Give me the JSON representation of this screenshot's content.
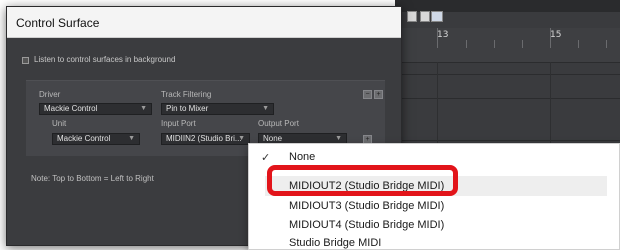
{
  "timeline": {
    "markers": [
      "13",
      "15"
    ]
  },
  "dialog": {
    "title": "Control Surface",
    "background_listen_label": "Listen to control surfaces in background",
    "headers": {
      "driver": "Driver",
      "track_filtering": "Track Filtering",
      "unit": "Unit",
      "input_port": "Input Port",
      "output_port": "Output Port"
    },
    "driver_value": "Mackie Control",
    "track_filtering_value": "Pin to Mixer",
    "unit_value": "Mackie Control",
    "input_port_value": "MIDIIN2 (Studio Bri...",
    "output_port_value": "None",
    "note": "Note: Top to Bottom = Left to Right"
  },
  "menu": {
    "items": [
      {
        "label": "None",
        "checked": true
      },
      {
        "label": "MIDIOUT2 (Studio Bridge MIDI)",
        "highlighted": true
      },
      {
        "label": "MIDIOUT3 (Studio Bridge MIDI)"
      },
      {
        "label": "MIDIOUT4 (Studio Bridge MIDI)"
      },
      {
        "label": "Studio Bridge MIDI"
      }
    ]
  },
  "colors": {
    "annotation_ring": "#e2141a",
    "dialog_bg": "#3b3c3f",
    "menu_highlight": "#eeeeee"
  }
}
